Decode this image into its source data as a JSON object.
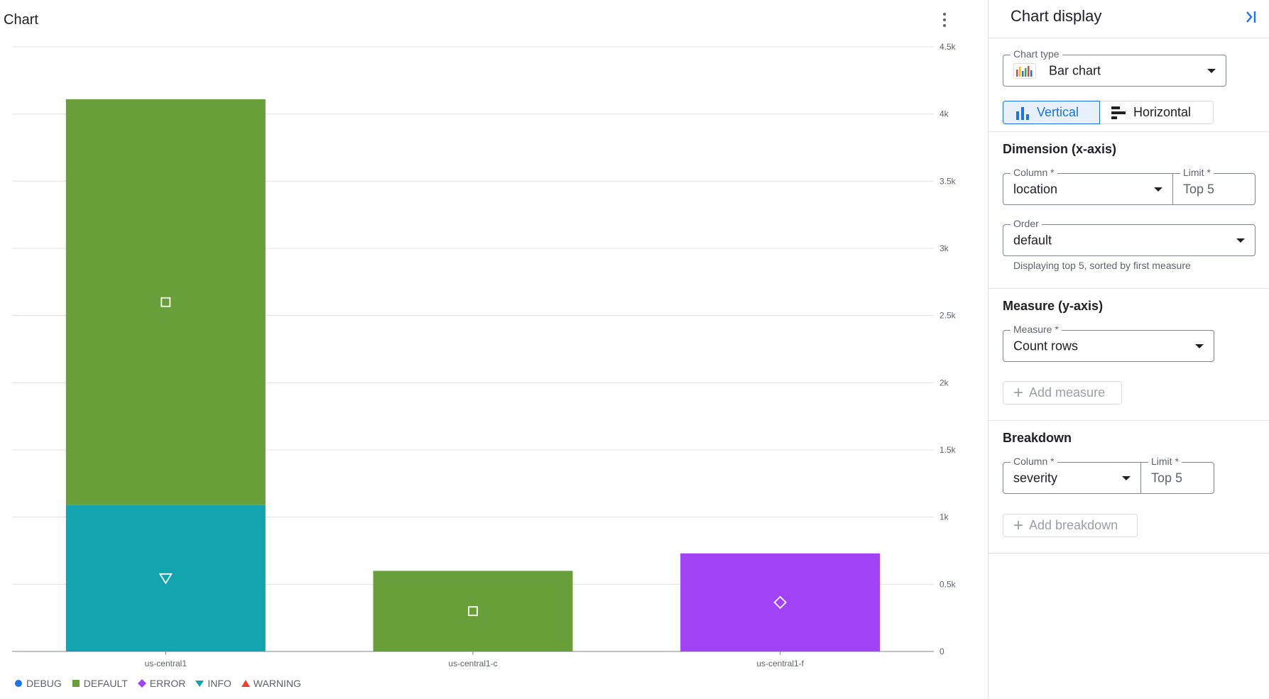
{
  "chart": {
    "title": "Chart",
    "more_icon": "more-vert-icon"
  },
  "chart_data": {
    "type": "bar",
    "stacked": true,
    "categories": [
      "us-central1",
      "us-central1-c",
      "us-central1-f"
    ],
    "series": [
      {
        "name": "DEBUG",
        "color": "#1a73e8",
        "marker": "circle",
        "values": [
          0,
          0,
          0
        ]
      },
      {
        "name": "DEFAULT",
        "color": "#689f38",
        "marker": "square",
        "values": [
          3020,
          600,
          0
        ]
      },
      {
        "name": "ERROR",
        "color": "#a142f4",
        "marker": "diamond",
        "values": [
          0,
          0,
          730
        ]
      },
      {
        "name": "INFO",
        "color": "#12a4af",
        "marker": "triangle-down",
        "values": [
          1090,
          0,
          0
        ]
      },
      {
        "name": "WARNING",
        "color": "#ea4335",
        "marker": "triangle-up",
        "values": [
          0,
          0,
          0
        ]
      }
    ],
    "ylim": [
      0,
      4500
    ],
    "yticks": [
      0,
      500,
      1000,
      1500,
      2000,
      2500,
      3000,
      3500,
      4000,
      4500
    ],
    "ytick_labels": [
      "0",
      "0.5k",
      "1k",
      "1.5k",
      "2k",
      "2.5k",
      "3k",
      "3.5k",
      "4k",
      "4.5k"
    ],
    "grid": true,
    "y_axis_side": "right",
    "legend_position": "bottom-left",
    "xlabel": "",
    "ylabel": ""
  },
  "panel": {
    "title": "Chart display",
    "collapse_icon": "collapse-panel-icon",
    "chart_type": {
      "label": "Chart type",
      "value": "Bar chart",
      "icon": "bar-chart-icon"
    },
    "orientation": {
      "vertical": "Vertical",
      "horizontal": "Horizontal",
      "selected": "Vertical"
    },
    "dimension": {
      "heading": "Dimension (x-axis)",
      "column_label": "Column *",
      "column_value": "location",
      "limit_label": "Limit *",
      "limit_value": "Top 5",
      "order_label": "Order",
      "order_value": "default",
      "hint": "Displaying top 5, sorted by first measure"
    },
    "measure": {
      "heading": "Measure (y-axis)",
      "label": "Measure *",
      "value": "Count rows",
      "add_label": "Add measure"
    },
    "breakdown": {
      "heading": "Breakdown",
      "column_label": "Column *",
      "column_value": "severity",
      "limit_label": "Limit *",
      "limit_value": "Top 5",
      "add_label": "Add breakdown"
    }
  },
  "colors": {
    "accent": "#1a73e8",
    "border": "#80868b",
    "divider": "#e0e0e0"
  }
}
